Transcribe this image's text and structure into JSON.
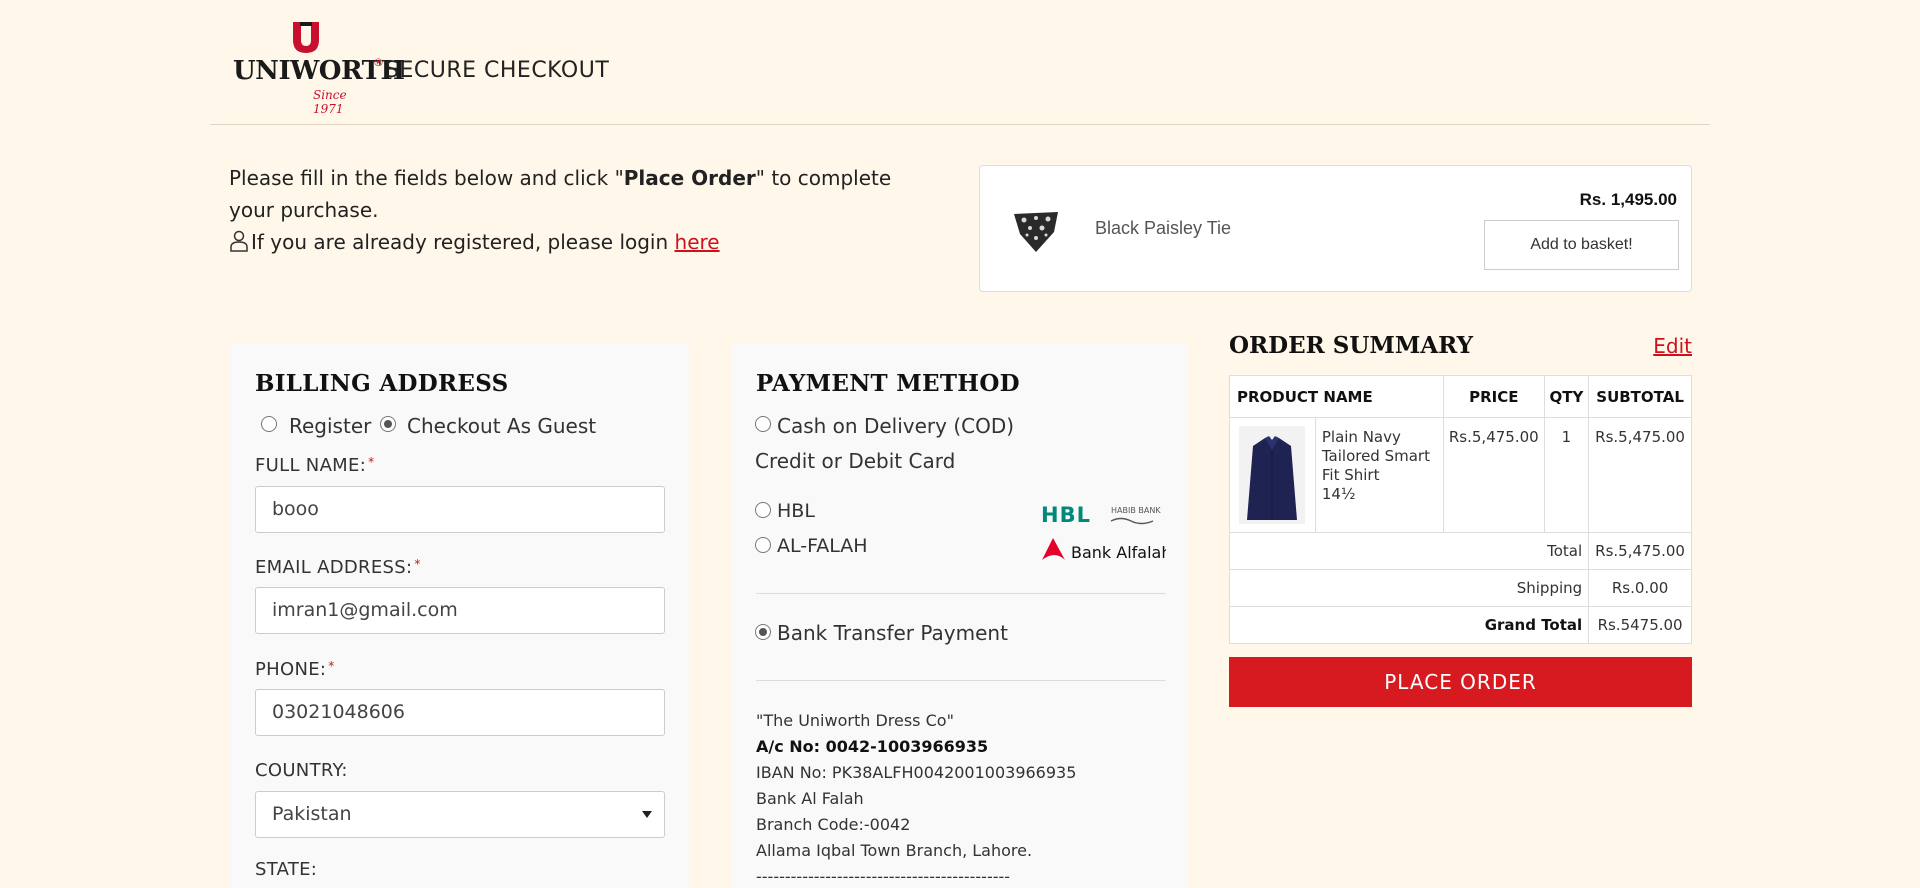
{
  "header": {
    "brand": "UNIWORTH",
    "registered": "®",
    "since": "Since 1971",
    "title": "SECURE CHECKOUT"
  },
  "intro": {
    "text_before": "Please fill in the fields below and click \"",
    "place_order_bold": "Place Order",
    "text_after": "\" to complete your purchase.",
    "login_text": "If you are already registered, please login ",
    "login_link": "here"
  },
  "promo": {
    "product_name": "Black Paisley Tie",
    "price": "Rs. 1,495.00",
    "button_label": "Add to basket!"
  },
  "billing": {
    "title": "BILLING ADDRESS",
    "register_label": "Register",
    "guest_label": "Checkout As Guest",
    "selected_mode": "guest",
    "full_name_label": "FULL NAME:",
    "full_name_value": "booo",
    "email_label": "EMAIL ADDRESS:",
    "email_value": "imran1@gmail.com",
    "phone_label": "PHONE:",
    "phone_value": "03021048606",
    "country_label": "COUNTRY:",
    "country_value": "Pakistan",
    "state_label": "STATE:",
    "required_mark": "*"
  },
  "payment": {
    "title": "PAYMENT METHOD",
    "cod_label": "Cash on Delivery (COD)",
    "card_heading": "Credit or Debit Card",
    "hbl_label": "HBL",
    "alfalah_label": "AL-FALAH",
    "bank_transfer_label": "Bank Transfer Payment",
    "selected": "bank_transfer",
    "hbl_logo_text": "HBL",
    "habib_text": "HABIB BANK",
    "alfalah_logo_text": "Bank Alfalah",
    "bank_info": {
      "company": "\"The Uniworth Dress Co\"",
      "account": "A/c No: 0042-1003966935",
      "iban": "IBAN No: PK38ALFH0042001003966935",
      "bank": "Bank Al Falah",
      "branch_code": "Branch Code:-0042",
      "branch": "Allama Iqbal Town Branch, Lahore.",
      "separator": "--------------------------------------------"
    }
  },
  "summary": {
    "title": "ORDER SUMMARY",
    "edit_label": "Edit",
    "columns": [
      "PRODUCT NAME",
      "PRICE",
      "QTY",
      "SUBTOTAL"
    ],
    "item": {
      "name": "Plain Navy Tailored Smart Fit Shirt",
      "size": "14½",
      "price": "Rs.5,475.00",
      "qty": "1",
      "subtotal": "Rs.5,475.00"
    },
    "total_label": "Total",
    "total_value": "Rs.5,475.00",
    "shipping_label": "Shipping",
    "shipping_value": "Rs.0.00",
    "grand_total_label": "Grand Total",
    "grand_total_value": "Rs.5475.00",
    "place_order_label": "PLACE ORDER"
  },
  "colors": {
    "background": "#fff8ea",
    "accent_red": "#d71a20",
    "hbl_green": "#00897b"
  }
}
